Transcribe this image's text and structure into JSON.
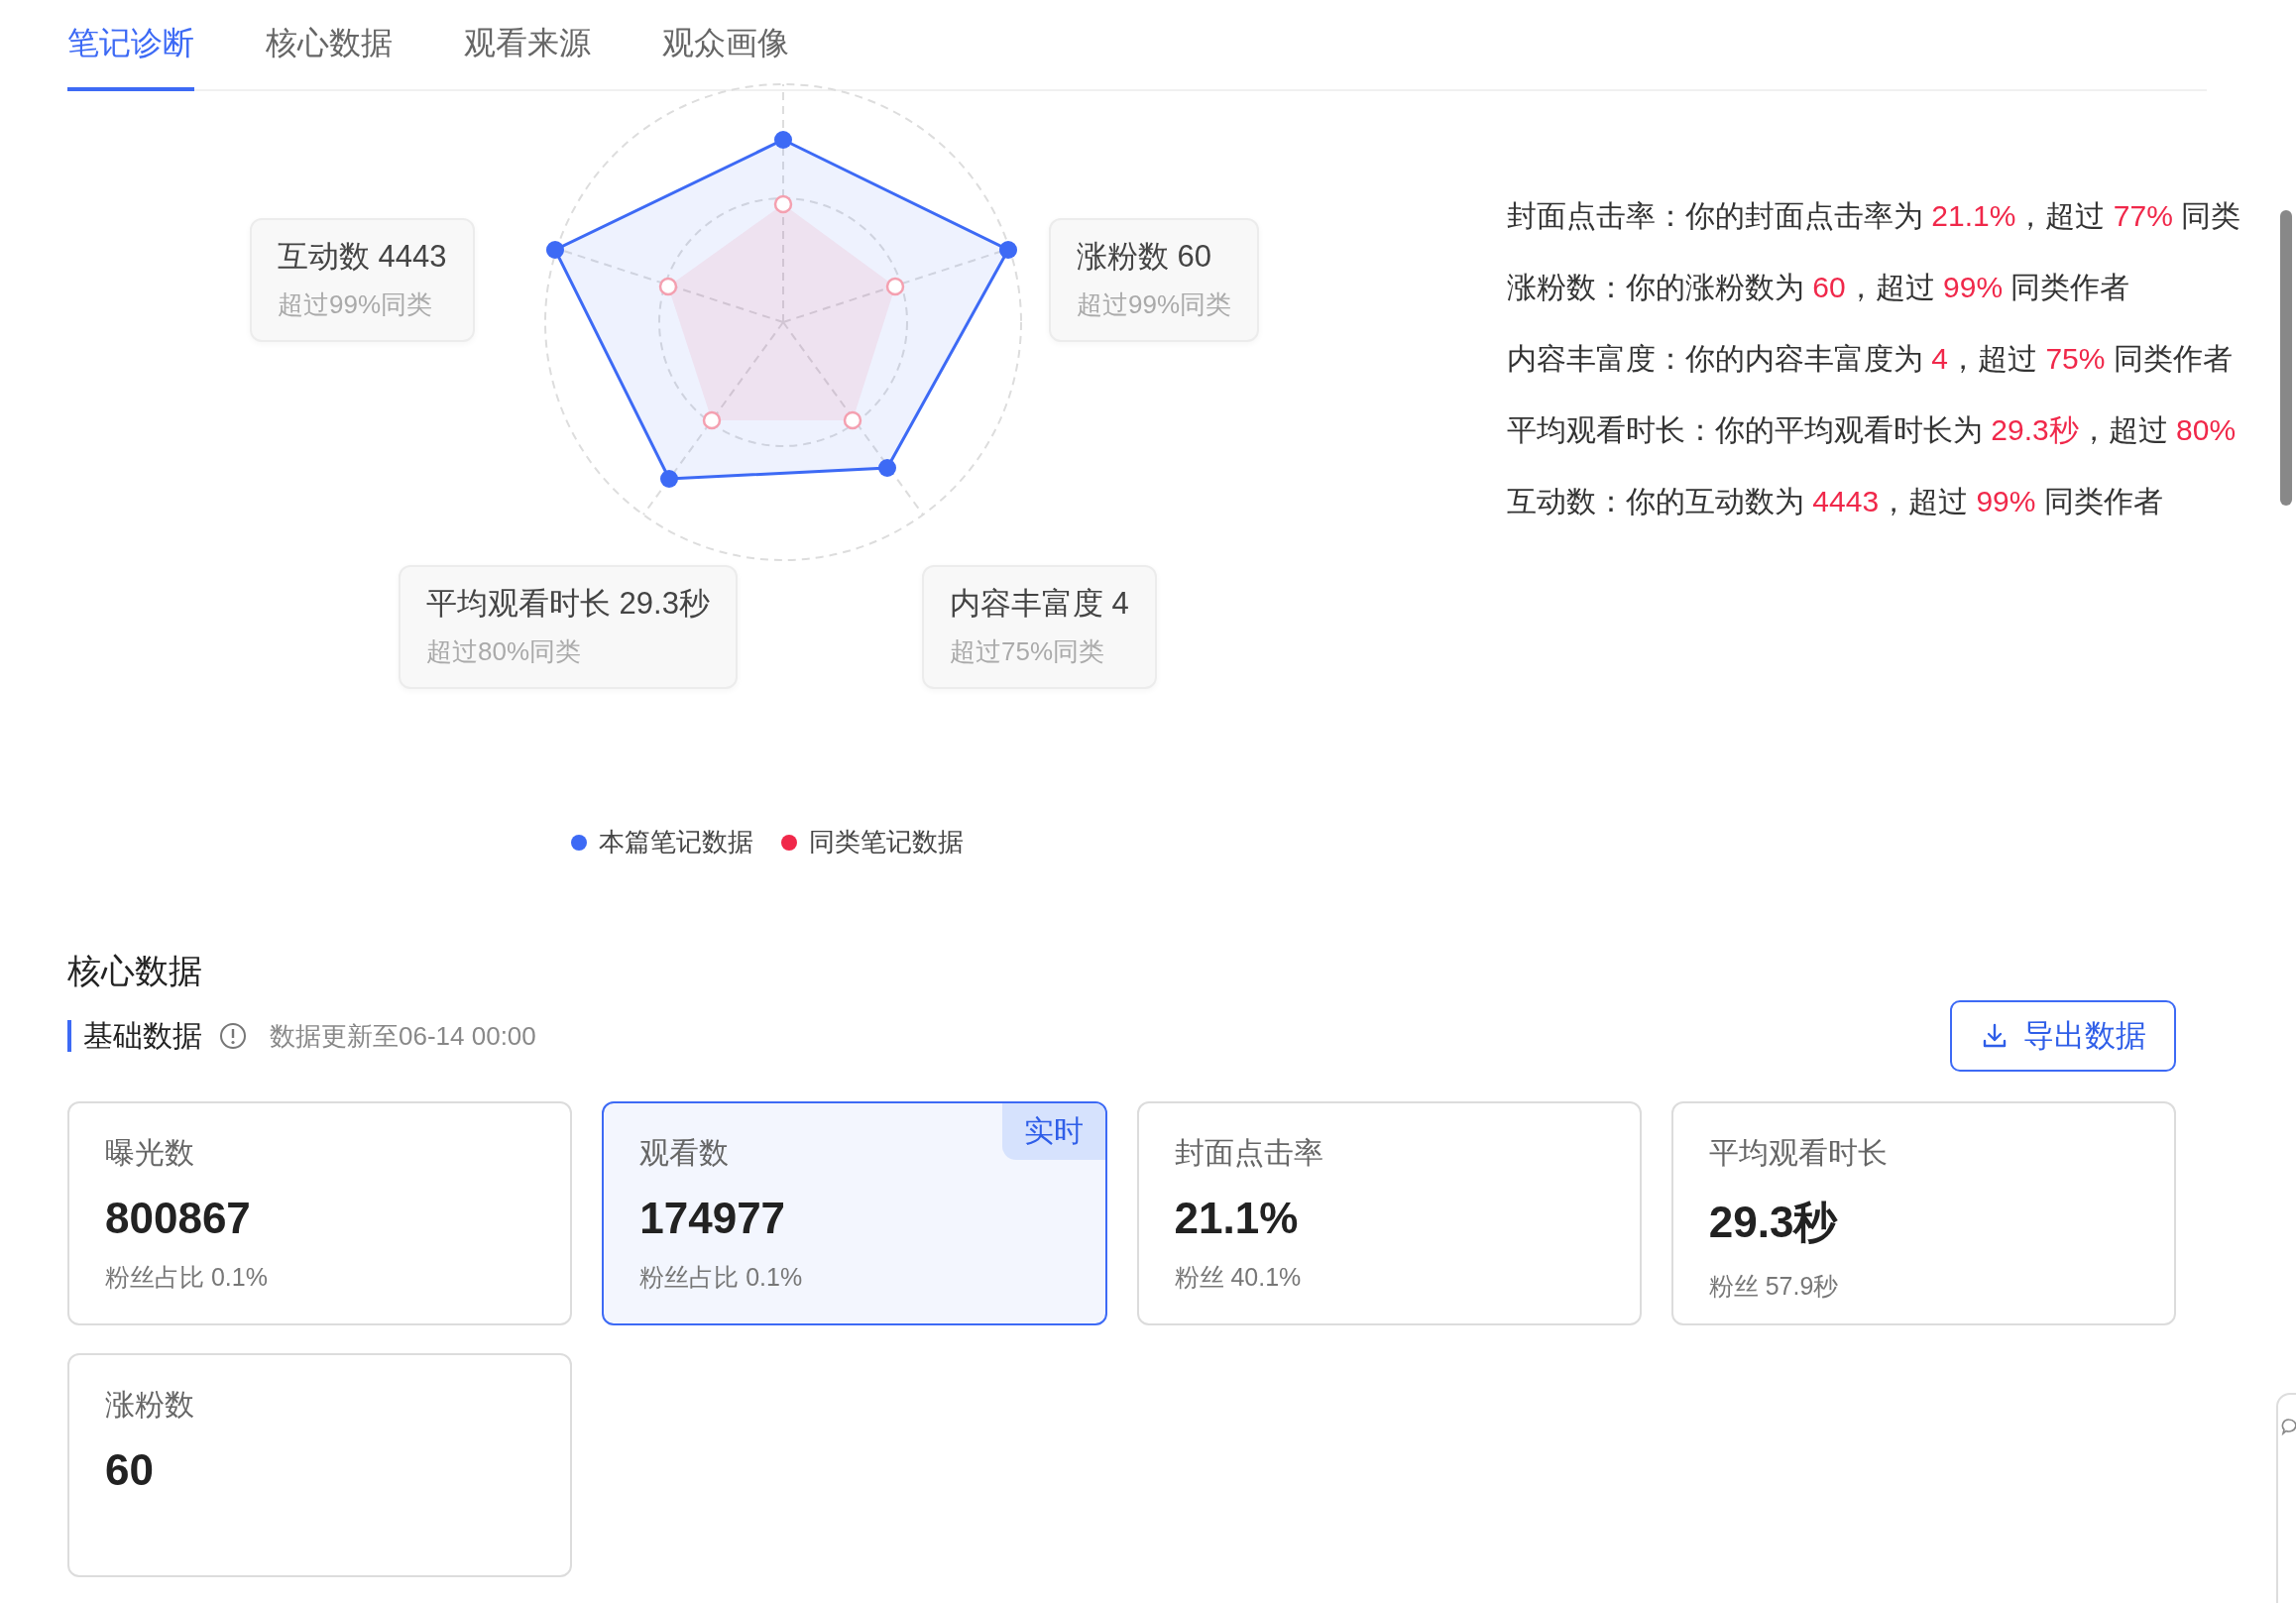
{
  "tabs": [
    {
      "label": "笔记诊断",
      "selected": true
    },
    {
      "label": "核心数据",
      "selected": false
    },
    {
      "label": "观看来源",
      "selected": false
    },
    {
      "label": "观众画像",
      "selected": false
    }
  ],
  "radar": {
    "labels": [
      {
        "title": "互动数 4443",
        "sub": "超过99%同类"
      },
      {
        "title": "涨粉数 60",
        "sub": "超过99%同类"
      },
      {
        "title": "平均观看时长 29.3秒",
        "sub": "超过80%同类"
      },
      {
        "title": "内容丰富度 4",
        "sub": "超过75%同类"
      }
    ],
    "legend": [
      {
        "label": "本篇笔记数据",
        "color": "#3d6af5"
      },
      {
        "label": "同类笔记数据",
        "color": "#f0284a"
      }
    ]
  },
  "summary": [
    {
      "parts": [
        {
          "text": "封面点击率：你的封面点击率为 ",
          "emphasis": false
        },
        {
          "text": "21.1%",
          "emphasis": true
        },
        {
          "text": "，超过 ",
          "emphasis": false
        },
        {
          "text": "77%",
          "emphasis": true
        },
        {
          "text": " 同类",
          "emphasis": false
        }
      ]
    },
    {
      "parts": [
        {
          "text": "涨粉数：你的涨粉数为 ",
          "emphasis": false
        },
        {
          "text": "60",
          "emphasis": true
        },
        {
          "text": "，超过 ",
          "emphasis": false
        },
        {
          "text": "99%",
          "emphasis": true
        },
        {
          "text": " 同类作者",
          "emphasis": false
        }
      ]
    },
    {
      "parts": [
        {
          "text": "内容丰富度：你的内容丰富度为 ",
          "emphasis": false
        },
        {
          "text": "4",
          "emphasis": true
        },
        {
          "text": "，超过 ",
          "emphasis": false
        },
        {
          "text": "75%",
          "emphasis": true
        },
        {
          "text": " 同类作者",
          "emphasis": false
        }
      ]
    },
    {
      "parts": [
        {
          "text": "平均观看时长：你的平均观看时长为 ",
          "emphasis": false
        },
        {
          "text": "29.3秒",
          "emphasis": true
        },
        {
          "text": "，超过 ",
          "emphasis": false
        },
        {
          "text": "80%",
          "emphasis": true
        }
      ]
    },
    {
      "parts": [
        {
          "text": "互动数：你的互动数为 ",
          "emphasis": false
        },
        {
          "text": "4443",
          "emphasis": true
        },
        {
          "text": "，超过 ",
          "emphasis": false
        },
        {
          "text": "99%",
          "emphasis": true
        },
        {
          "text": " 同类作者",
          "emphasis": false
        }
      ]
    }
  ],
  "core": {
    "title": "核心数据",
    "section": "基础数据",
    "updated": "数据更新至06-14 00:00",
    "export_button": "导出数据",
    "cards": [
      {
        "label": "曝光数",
        "value": "800867",
        "sub": "粉丝占比 0.1%",
        "selected": false
      },
      {
        "label": "观看数",
        "value": "174977",
        "sub": "粉丝占比 0.1%",
        "selected": true,
        "badge": "实时"
      },
      {
        "label": "封面点击率",
        "value": "21.1%",
        "sub": "粉丝 40.1%",
        "selected": false
      },
      {
        "label": "平均观看时长",
        "value": "29.3秒",
        "sub": "粉丝 57.9秒",
        "selected": false
      },
      {
        "label": "涨粉数",
        "value": "60",
        "selected": false
      }
    ]
  }
}
